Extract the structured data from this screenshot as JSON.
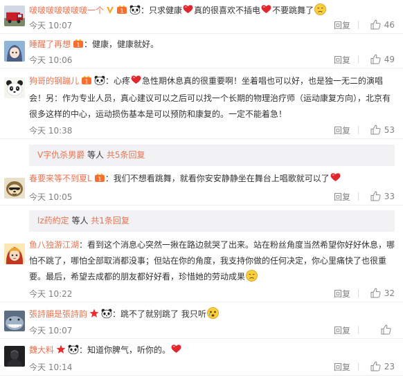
{
  "comments": [
    {
      "name": "啵啵啵啵啵啵啵一个",
      "text_parts": [
        "只求健康",
        "真的很喜欢不插电",
        "不要跳舞了"
      ],
      "time": "今天 10:07",
      "reply": "回复",
      "likes": "46",
      "avatar_icon": "fire-truck-avatar"
    },
    {
      "name": "睡醒了再想",
      "text_parts": [
        "健康，健康就好。"
      ],
      "time": "今天 10:06",
      "reply": "回复",
      "likes": "49",
      "avatar_icon": "anime-girl-avatar"
    },
    {
      "name": "狗哥的钢蹦儿",
      "text_parts": [
        "心疼",
        "急性期休息真的很重要啊！坐着唱也可以好，也是独一无二的演唱",
        "会！另：作为专业人员，真心建议可以之后可以找一个长期的物理治疗师（运动康复方向），北京有",
        "很多这样的中心，运动损伤基本是可以预防和康复的。一定不能着急！"
      ],
      "time": "今天 10:38",
      "reply": "回复",
      "likes": "53",
      "avatar_icon": "panda-avatar",
      "sub": {
        "link": "V字仇杀男爵",
        "rest": " 等人 ",
        "count": "共5条回复"
      }
    },
    {
      "name": "春要来等不到夏L",
      "text_parts": [
        "我们不想看跳舞，就看你安安静静坐在舞台上唱歌就可以了"
      ],
      "time": "今天 10:05",
      "reply": "回复",
      "likes": "33",
      "avatar_icon": "sloth-avatar",
      "sub": {
        "link": "lz药約定",
        "rest": " 等人 ",
        "count": "共1条回复"
      }
    },
    {
      "name": "鱼八独游江湖",
      "text_parts": [
        "看到这个消息心突然一揪在路边就哭了出来。站在粉丝角度当然希望你好好休",
        "息，哪怕不跳了，哪怕全部取消都没事；但站在你的角度，我支持你做的任何决定，你心里痛快了",
        "也很重要。最后，希望去成都的朋友都好好看，珍惜她的劳动成果"
      ],
      "time": "今天 10:22",
      "reply": "回复",
      "likes": "32",
      "avatar_icon": "cartoon-girl-avatar"
    },
    {
      "name": "張詩韻是張詩韵",
      "text_parts": [
        "跳不了就别跳了 我只听"
      ],
      "time": "今天 10:07",
      "reply": "回复",
      "likes": "",
      "avatar_icon": "shark-avatar"
    },
    {
      "name": "魏大料",
      "text_parts": [
        "知道你脾气，听你的。"
      ],
      "time": "今天 10:14",
      "reply": "回复",
      "likes": "23",
      "avatar_icon": "dark-photo-avatar"
    }
  ],
  "colors": {
    "username": "#eb7350",
    "meta": "#808080",
    "subbox_bg": "#f2f2f5"
  }
}
